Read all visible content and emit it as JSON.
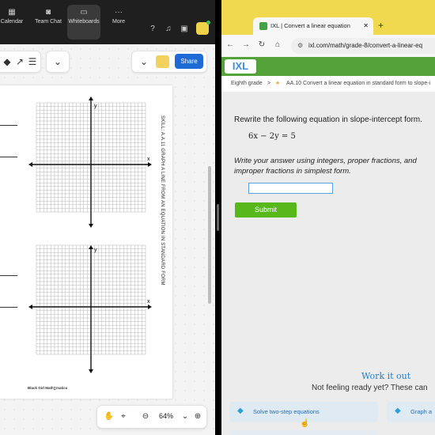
{
  "zoom_toolbar": {
    "items": [
      {
        "label": "Calendar",
        "icon": "calendar-icon"
      },
      {
        "label": "Team Chat",
        "icon": "chat-icon"
      },
      {
        "label": "Whiteboards",
        "icon": "whiteboard-icon"
      },
      {
        "label": "More",
        "icon": "more-icon"
      }
    ],
    "active": "Whiteboards"
  },
  "whiteboard": {
    "share_label": "Share",
    "zoom_level": "64%",
    "worksheet": {
      "title": "SKILL: A.A.11 GRAPH A LINE FROM AN EQUATION IN STANDARD FORM",
      "brand": "Black Girl Math∑matics",
      "axis_x": "x",
      "axis_y": "y"
    }
  },
  "browser": {
    "tab_title": "IXL | Convert a linear equation",
    "new_tab": "+",
    "url": "ixl.com/math/grade-8/convert-a-linear-eq",
    "logo": "IXL",
    "breadcrumb": {
      "grade": "Eighth grade",
      "separator": ">",
      "skill": "AA.10 Convert a linear equation in standard form to slope-i"
    }
  },
  "question": {
    "prompt": "Rewrite the following equation in slope-intercept form.",
    "equation": "6x − 2y = 5",
    "instructions": "Write your answer using integers, proper fractions, and improper fractions in simplest form.",
    "answer_value": "",
    "submit_label": "Submit"
  },
  "help": {
    "heading": "Work it out",
    "subtext": "Not feeling ready yet? These can",
    "cards": [
      {
        "label": "Solve two-step equations"
      },
      {
        "label": "Graph a"
      }
    ]
  },
  "colors": {
    "share_blue": "#1e6bd6",
    "submit_green": "#58b81b",
    "ixl_green": "#56a23a",
    "tab_strip_yellow": "#f0d84f"
  }
}
